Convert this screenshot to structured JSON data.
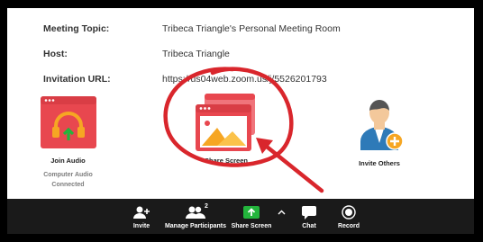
{
  "meeting": {
    "topic_label": "Meeting Topic:",
    "topic_value": "Tribeca Triangle's Personal Meeting Room",
    "host_label": "Host:",
    "host_value": "Tribeca Triangle",
    "url_label": "Invitation URL:",
    "url_value": "https://us04web.zoom.us/j/5526201793"
  },
  "features": {
    "join_audio": "Join Audio",
    "audio_status_line1": "Computer Audio",
    "audio_status_line2": "Connected",
    "share_screen": "Share Screen",
    "invite_others": "Invite Others"
  },
  "toolbar": {
    "invite": "Invite",
    "manage_participants": "Manage Participants",
    "participant_count": "2",
    "share_screen": "Share Screen",
    "chat": "Chat",
    "record": "Record"
  },
  "colors": {
    "accent_red": "#e8474f",
    "share_green": "#23b53c",
    "toolbar_bg": "#1a1a1a",
    "annotation_red": "#d9262c"
  }
}
